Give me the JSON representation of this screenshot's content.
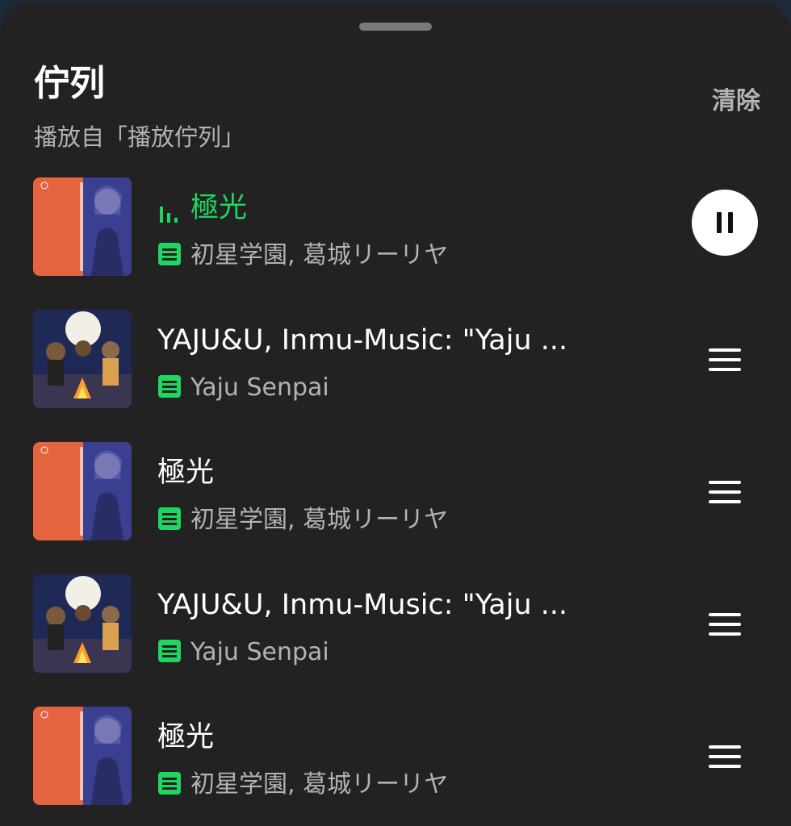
{
  "header": {
    "title": "佇列",
    "subtitle": "播放自「播放佇列」",
    "clear_label": "清除"
  },
  "colors": {
    "accent": "#1ed760",
    "background": "#222222",
    "secondary_text": "#b3b3b3"
  },
  "queue": [
    {
      "title": "極光",
      "artist": "初星学園, 葛城リーリヤ",
      "cover": "hatsuboshi-gakuen-cover",
      "playing": true,
      "action_icon": "pause-icon"
    },
    {
      "title": "YAJU&U, Inmu-Music: \"Yaju ...",
      "artist": "Yaju Senpai",
      "cover": "cats-campfire-cover",
      "playing": false,
      "action_icon": "drag-handle-icon"
    },
    {
      "title": "極光",
      "artist": "初星学園, 葛城リーリヤ",
      "cover": "hatsuboshi-gakuen-cover",
      "playing": false,
      "action_icon": "drag-handle-icon"
    },
    {
      "title": "YAJU&U, Inmu-Music: \"Yaju ...",
      "artist": "Yaju Senpai",
      "cover": "cats-campfire-cover",
      "playing": false,
      "action_icon": "drag-handle-icon"
    },
    {
      "title": "極光",
      "artist": "初星学園, 葛城リーリヤ",
      "cover": "hatsuboshi-gakuen-cover",
      "playing": false,
      "action_icon": "drag-handle-icon"
    }
  ]
}
